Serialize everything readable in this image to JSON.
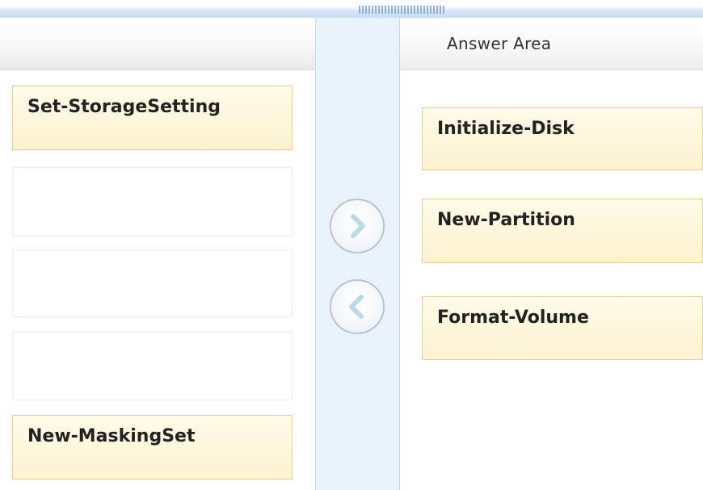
{
  "answer_area": {
    "title": "Answer Area"
  },
  "left_items": [
    {
      "label": "Set-StorageSetting"
    },
    {
      "label": ""
    },
    {
      "label": ""
    },
    {
      "label": ""
    },
    {
      "label": "New-MaskingSet"
    }
  ],
  "right_items": [
    {
      "label": "Initialize-Disk"
    },
    {
      "label": "New-Partition"
    },
    {
      "label": "Format-Volume"
    }
  ],
  "icons": {
    "move_right": "chevron-right-icon",
    "move_left": "chevron-left-icon"
  },
  "colors": {
    "item_fill": "#fcf3cf",
    "item_border": "#e3cf8e",
    "middle_column": "#e9f1fb"
  }
}
